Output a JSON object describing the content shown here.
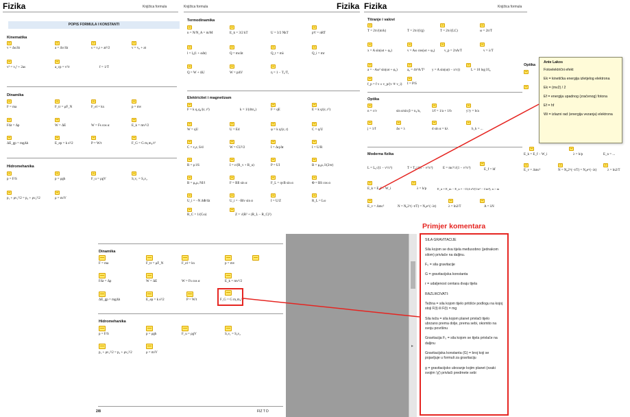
{
  "pages": {
    "p1": {
      "title": "Fizika",
      "booklet": "Knjižica formula",
      "banner": "POPIS FORMULA I KONSTANTI",
      "sections": {
        "kinematika": "Kinematika",
        "dinamika": "Dinamika",
        "hidromehanika": "Hidromehanika"
      },
      "kin": [
        "v = Δs/Δt",
        "a = Δv/Δt",
        "s = v₀t + at²/2",
        "v = v₀ + at",
        "v² = v₀² + 2as",
        "a_cp = v²/r",
        "f = 1/T"
      ],
      "din": [
        "F = ma",
        "F_tr = μF_N",
        "F_el = kx",
        "p = mv",
        "FΔt = Δp",
        "W = ΔE",
        "W = Fs cos α",
        "E_k = mv²/2",
        "ΔE_gp = mgΔh",
        "E_ep = k s²/2",
        "P = W/t",
        "F_G = G m₁m₂/r²"
      ],
      "hid": [
        "p = F/S",
        "p = ρgh",
        "F_u = ρgV",
        "S₁v₁ = S₂v₂",
        "p₁ + ρv₁²/2 = p₂ + ρv₂²/2",
        "ρ = m/V"
      ]
    },
    "p2": {
      "booklet": "Knjižica formula",
      "title": "Fizika",
      "sections": {
        "termo": "Termodinamika",
        "elek": "Elektricitet i magnetizam"
      },
      "termo": [
        "n = N/N_A = m/M",
        "E_k = 3/2 kT",
        "U = 3/2 NkT",
        "pV = nRT",
        "l = l₀(1 + αΔt)",
        "Q = mcΔt",
        "Q_t = mλ",
        "Q_i = mr",
        "Q = W + ΔU",
        "W = pΔV",
        "η = 1 − T₂/T₁"
      ],
      "elek": [
        "F = k q₁q₂/(εᵣ r²)",
        "k = 1/(4πε₀)",
        "F = qE",
        "E = k q/(εᵣ r²)",
        "W = qU",
        "U = Ed",
        "φ = k q/(εᵣ r)",
        "C = q/U",
        "C = ε₀εᵣ S/d",
        "W = CU²/2",
        "I = Δq/Δt",
        "I = U/R",
        "R = ρ l/S",
        "I = ε/(R_v + R_u)",
        "P = UI",
        "B = μ₀μᵣ I/(2πr)",
        "B = μ₀μᵣ NI/l",
        "F = BIl sin α",
        "F_L = qvB sin α",
        "Φ = BS cos α",
        "U_i = −N ΔΦ/Δt",
        "U_i = −Blv sin α",
        "I = U/Z",
        "R_L = Lω",
        "R_C = 1/(Cω)",
        "Z = √(R² + (R_L − R_C)²)"
      ]
    },
    "p3": {
      "title": "Fizika",
      "booklet": "Knjižica formula",
      "sections": {
        "titranje": "Titranje i valovi",
        "optika": "Optika",
        "moderna": "Moderna fizika"
      },
      "tit": [
        "T = 2π√(m/k)",
        "T = 2π√(l/g)",
        "T = 2π√(LC)",
        "ω = 2π/T",
        "x = A sin(ωt + φ₀)",
        "v = Aω cos(ωt + φ₀)",
        "v_p = 2πA/T",
        "v = λ/T",
        "a = −Aω² sin(ωt + φ₀)",
        "a₀ = 4π²A/T²",
        "y = A sin(ω(t − x/v))",
        "L = 10 log I/I₀",
        "f_p = f v ± v_p/(v ∓ v_i)",
        "I = P/S"
      ],
      "opt": [
        "n = c/v",
        "sin α/sin β = n₂/n₁",
        "1/f = 1/a + 1/b",
        "y'/y = b/a",
        "j = 1/f",
        "Δs = λ",
        "d sin α = kλ",
        "h_k = ..."
      ],
      "mod": [
        "L = L₀√(1 − v²/c²)",
        "T = T₀/√(1 − v²/c²)",
        "E = mc²/√(1 − v²/c²)",
        "E_f = hf",
        "E_k = E_f − W_i",
        "λ = h/p",
        "E_n = E_m − E_n = −13,6 eV(1/n² − 1/m²), n > m",
        "E_v = Δmc²",
        "N = N₀2^(−t/T) = N₀e^(−λt)",
        "λ = ln2/T",
        "A = λN"
      ]
    },
    "p4": {
      "sections": {
        "dinamika": "Dinamika",
        "hidromehanika": "Hidromehanika"
      },
      "din": [
        "F = ma",
        "F_tr = μF_N",
        "F_el = kx",
        "p = mv",
        "FΔt = Δp",
        "W = ΔE",
        "W = Fs cos α",
        "E_k = mv²/2",
        "ΔE_gp = mgΔh",
        "E_ep = k s²/2",
        "P = W/t",
        "F_G = G m₁m₂/r²"
      ],
      "hid": [
        "p = F/S",
        "p = ρgh",
        "F_u = ρgV",
        "S₁v₁ = S₂v₂",
        "p₁ + ρv₁²/2 = p₂ + ρv₂²/2",
        "ρ = m/V"
      ],
      "page_num": "2/8",
      "footer": "FIZ T D"
    },
    "p5": {
      "eq_a": "E_k = E_f − W_i",
      "eq_b": "λ = h/p",
      "eq_c": "E_n = ...",
      "eq_d": "E_v = Δmc²",
      "eq_e": "N = N₀2^(−t/T) = N₀e^(−λt)",
      "eq_f": "λ = ln2/T",
      "opt": "Optika"
    }
  },
  "popup": {
    "author": "Ante Lakos",
    "lines": [
      "Fotoelektrični efekt",
      "Ek = kinetička energija izletjelog elektrona",
      "Ek = (mv2) / 2",
      "Ef = energija upadnog (zračenog) fotona",
      "Ef = hf",
      "Wi = izlazni rad (energija vezanja) elektrona"
    ]
  },
  "comment": {
    "label": "Primjer komentara",
    "heading": "SILA GRAVITACIJE",
    "p1": "Sila kojom se dva tijela međusobno (jednakom silom) privlače na daljinu.",
    "p2": "F₀ = sila gravitacije",
    "p3": "G = gravitacijska konstanta",
    "p4": "r = udaljenost centara dvaju tijela",
    "p5": "RAZLIKOVATI:",
    "p6": "Težina = sila kojom tijelo pritišće podlogu na kojoj stoji F(t) ili F(t) = mg",
    "p7": "Sila teža = sila kojom planet privlači tijelo ubrzano prema dolje, prema sebi, okomito na svoju površinu",
    "p8": "Gravitacija F₀ = sila kojom se tijela privlače na daljinu",
    "p9": "Gravitacijska konstanta (G) = broj koji se pojavljuje u formuli za gravitaciju",
    "p10": "g = gravitacijsko ubrzanje kojim planet (svaki svojim 'g') privlači predmete sebi"
  },
  "colors": {
    "accent_red": "#e52420",
    "note_yellow": "#ffe866",
    "banner_blue": "#dfeaf6"
  }
}
